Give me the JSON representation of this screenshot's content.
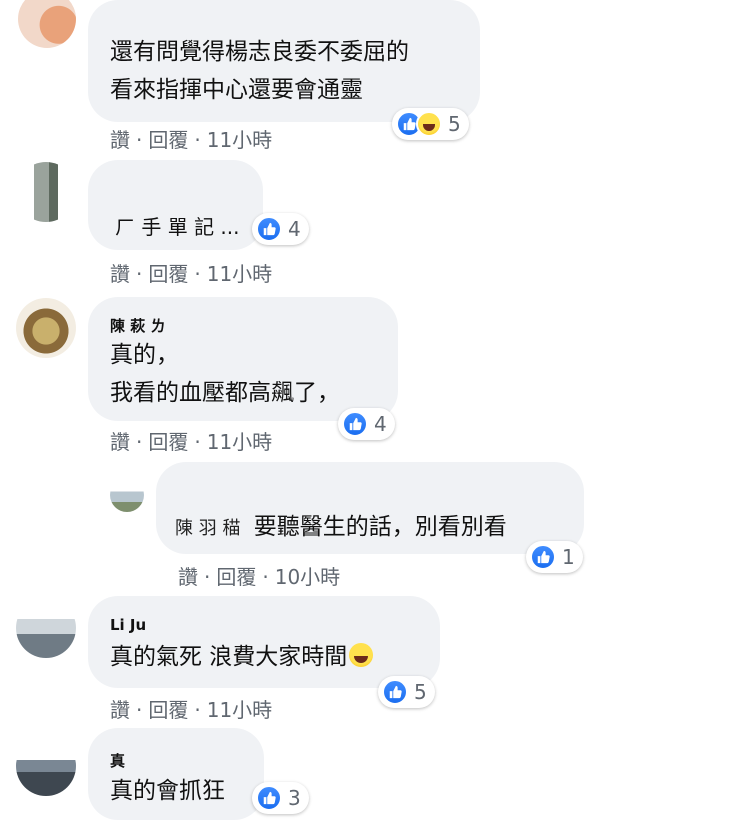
{
  "labels": {
    "like": "讚",
    "reply": "回覆",
    "dot": "·"
  },
  "comments": [
    {
      "lines": [
        "還有問覺得楊志良委不委屈的",
        "看來指揮中心還要會通靈"
      ],
      "reaction_count": "5",
      "time": "11小時"
    },
    {
      "lines": [
        "ㄏ 手 單 記 ..."
      ],
      "reaction_count": "4",
      "time": "11小時"
    },
    {
      "name": "陳 萩 ㄌ",
      "lines": [
        "真的，",
        "我看的血壓都高飆了，"
      ],
      "reaction_count": "4",
      "time": "11小時"
    },
    {
      "name_prefix": "陳 羽 䅦",
      "lines": [
        "要聽醫生的話，別看別看"
      ],
      "reaction_count": "1",
      "time": "10小時"
    },
    {
      "name": "Li Ju",
      "lines": [
        "真的氣死 浪費大家時間"
      ],
      "reaction_count": "5",
      "time": "11小時"
    },
    {
      "name": "真",
      "lines": [
        "真的會抓狂"
      ],
      "reaction_count": "3",
      "time": ""
    }
  ],
  "icons": {
    "like": "thumbs-up-icon",
    "haha": "laughing-emoji-icon",
    "inline_emoji": "tears-of-joy-emoji-icon"
  },
  "colors": {
    "bubble": "#f0f2f5",
    "like_blue": "#1b6ef0",
    "meta_gray": "#606770"
  }
}
